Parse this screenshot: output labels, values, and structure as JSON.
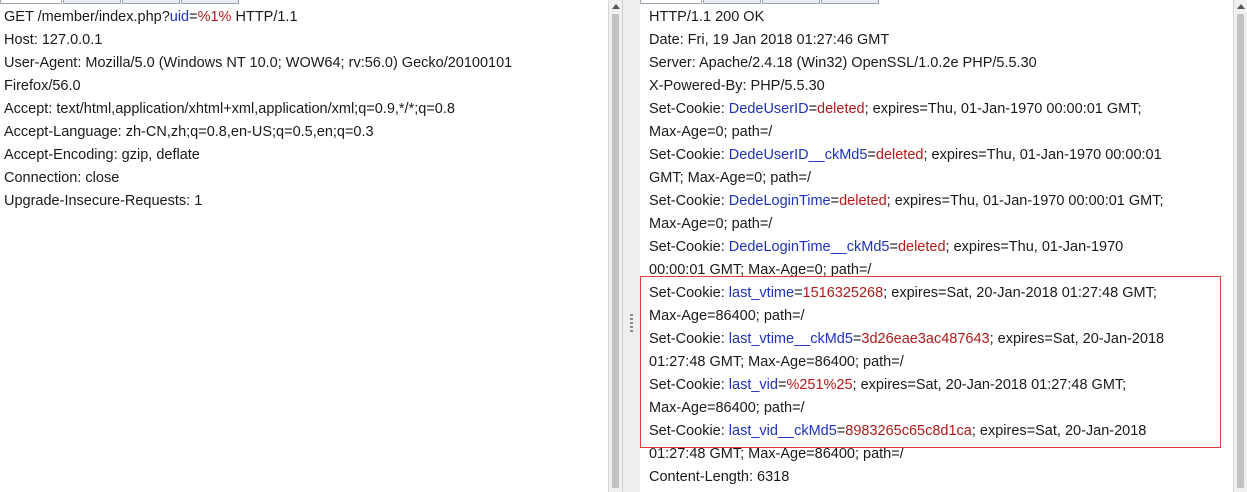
{
  "request": {
    "method": "GET",
    "path": "/member/index.php?",
    "param_key": "uid",
    "param_eq": "=",
    "param_val": "%1%",
    "protocol": " HTTP/1.1",
    "host": "Host: 127.0.0.1",
    "user_agent_1": "User-Agent: Mozilla/5.0 (Windows NT 10.0; WOW64; rv:56.0) Gecko/20100101",
    "user_agent_2": "Firefox/56.0",
    "accept": "Accept: text/html,application/xhtml+xml,application/xml;q=0.9,*/*;q=0.8",
    "accept_language": "Accept-Language: zh-CN,zh;q=0.8,en-US;q=0.5,en;q=0.3",
    "accept_encoding": "Accept-Encoding: gzip, deflate",
    "connection": "Connection: close",
    "upgrade": "Upgrade-Insecure-Requests: 1"
  },
  "response": {
    "status": "HTTP/1.1 200 OK",
    "date": "Date: Fri, 19 Jan 2018 01:27:46 GMT",
    "server": "Server: Apache/2.4.18 (Win32) OpenSSL/1.0.2e PHP/5.5.30",
    "powered": "X-Powered-By: PHP/5.5.30",
    "sc_prefix": "Set-Cookie: ",
    "eq": "=",
    "c1_key": "DedeUserID",
    "c1_val": "deleted",
    "c1_rest": "; expires=Thu, 01-Jan-1970 00:00:01 GMT;",
    "c1_cont": "Max-Age=0; path=/",
    "c2_key": "DedeUserID__ckMd5",
    "c2_val": "deleted",
    "c2_rest": "; expires=Thu, 01-Jan-1970 00:00:01",
    "c2_cont": "GMT; Max-Age=0; path=/",
    "c3_key": "DedeLoginTime",
    "c3_val": "deleted",
    "c3_rest": "; expires=Thu, 01-Jan-1970 00:00:01 GMT;",
    "c3_cont": "Max-Age=0; path=/",
    "c4_key": "DedeLoginTime__ckMd5",
    "c4_val": "deleted",
    "c4_rest": "; expires=Thu, 01-Jan-1970",
    "c4_cont": "00:00:01 GMT; Max-Age=0; path=/",
    "c5_key": "last_vtime",
    "c5_val": "1516325268",
    "c5_rest": "; expires=Sat, 20-Jan-2018 01:27:48 GMT;",
    "c5_cont": "Max-Age=86400; path=/",
    "c6_key": "last_vtime__ckMd5",
    "c6_val": "3d26eae3ac487643",
    "c6_rest": "; expires=Sat, 20-Jan-2018",
    "c6_cont": "01:27:48 GMT; Max-Age=86400; path=/",
    "c7_key": "last_vid",
    "c7_val": "%251%25",
    "c7_rest": "; expires=Sat, 20-Jan-2018 01:27:48 GMT;",
    "c7_cont": "Max-Age=86400; path=/",
    "c8_key": "last_vid__ckMd5",
    "c8_val": "8983265c65c8d1ca",
    "c8_rest": "; expires=Sat, 20-Jan-2018",
    "c8_cont": "01:27:48 GMT; Max-Age=86400; path=/",
    "content_length": "Content-Length: 6318"
  },
  "colors": {
    "param_key": "#1d33b8",
    "param_value": "#b31a1a",
    "highlight_border": "#e03a3a"
  }
}
